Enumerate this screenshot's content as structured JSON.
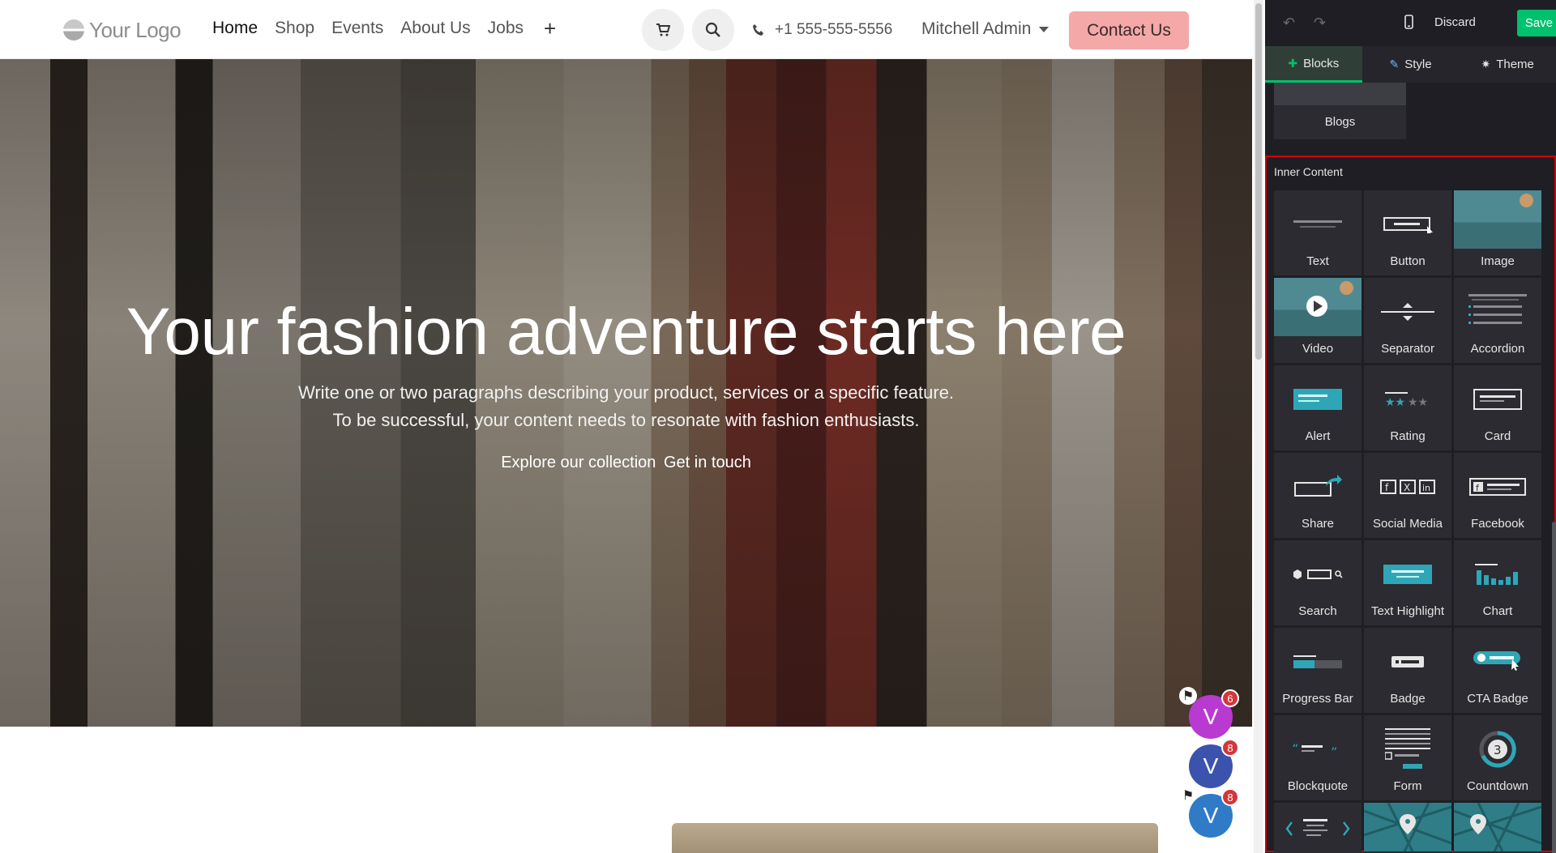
{
  "site": {
    "logo_text": "Your Logo",
    "menu": [
      {
        "label": "Home"
      },
      {
        "label": "Shop"
      },
      {
        "label": "Events"
      },
      {
        "label": "About Us"
      },
      {
        "label": "Jobs"
      }
    ],
    "menu_add": "+",
    "phone": "+1 555-555-5556",
    "user": "Mitchell Admin",
    "contact_label": "Contact Us"
  },
  "hero": {
    "title": "Your fashion adventure starts here",
    "paragraph_line1": "Write one or two paragraphs describing your product, services or a specific feature.",
    "paragraph_line2": "To be successful, your content needs to resonate with fashion enthusiasts.",
    "link_explore": "Explore our collection",
    "link_touch": "Get in touch"
  },
  "avatars": [
    {
      "initial": "V",
      "badge": "6",
      "color": "#b83ad0"
    },
    {
      "initial": "V",
      "badge": "8",
      "color": "#3c53ad"
    },
    {
      "initial": "V",
      "badge": "8",
      "color": "#2f7bc8"
    }
  ],
  "editor": {
    "discard_label": "Discard",
    "save_label": "Save",
    "tabs": [
      {
        "label": "Blocks",
        "icon": "plus-icon"
      },
      {
        "label": "Style",
        "icon": "brush-icon"
      },
      {
        "label": "Theme",
        "icon": "gear-icon"
      }
    ],
    "prev_block_label": "Blogs",
    "section_title": "Inner Content",
    "blocks": [
      {
        "label": "Text"
      },
      {
        "label": "Button"
      },
      {
        "label": "Image"
      },
      {
        "label": "Video"
      },
      {
        "label": "Separator"
      },
      {
        "label": "Accordion"
      },
      {
        "label": "Alert"
      },
      {
        "label": "Rating"
      },
      {
        "label": "Card"
      },
      {
        "label": "Share"
      },
      {
        "label": "Social Media"
      },
      {
        "label": "Facebook"
      },
      {
        "label": "Search"
      },
      {
        "label": "Text Highlight"
      },
      {
        "label": "Chart"
      },
      {
        "label": "Progress Bar"
      },
      {
        "label": "Badge"
      },
      {
        "label": "CTA Badge"
      },
      {
        "label": "Blockquote"
      },
      {
        "label": "Form"
      },
      {
        "label": "Countdown"
      },
      {
        "label": ""
      },
      {
        "label": ""
      },
      {
        "label": ""
      }
    ],
    "accent_color": "#00c16e",
    "highlight_color": "#d30000"
  }
}
